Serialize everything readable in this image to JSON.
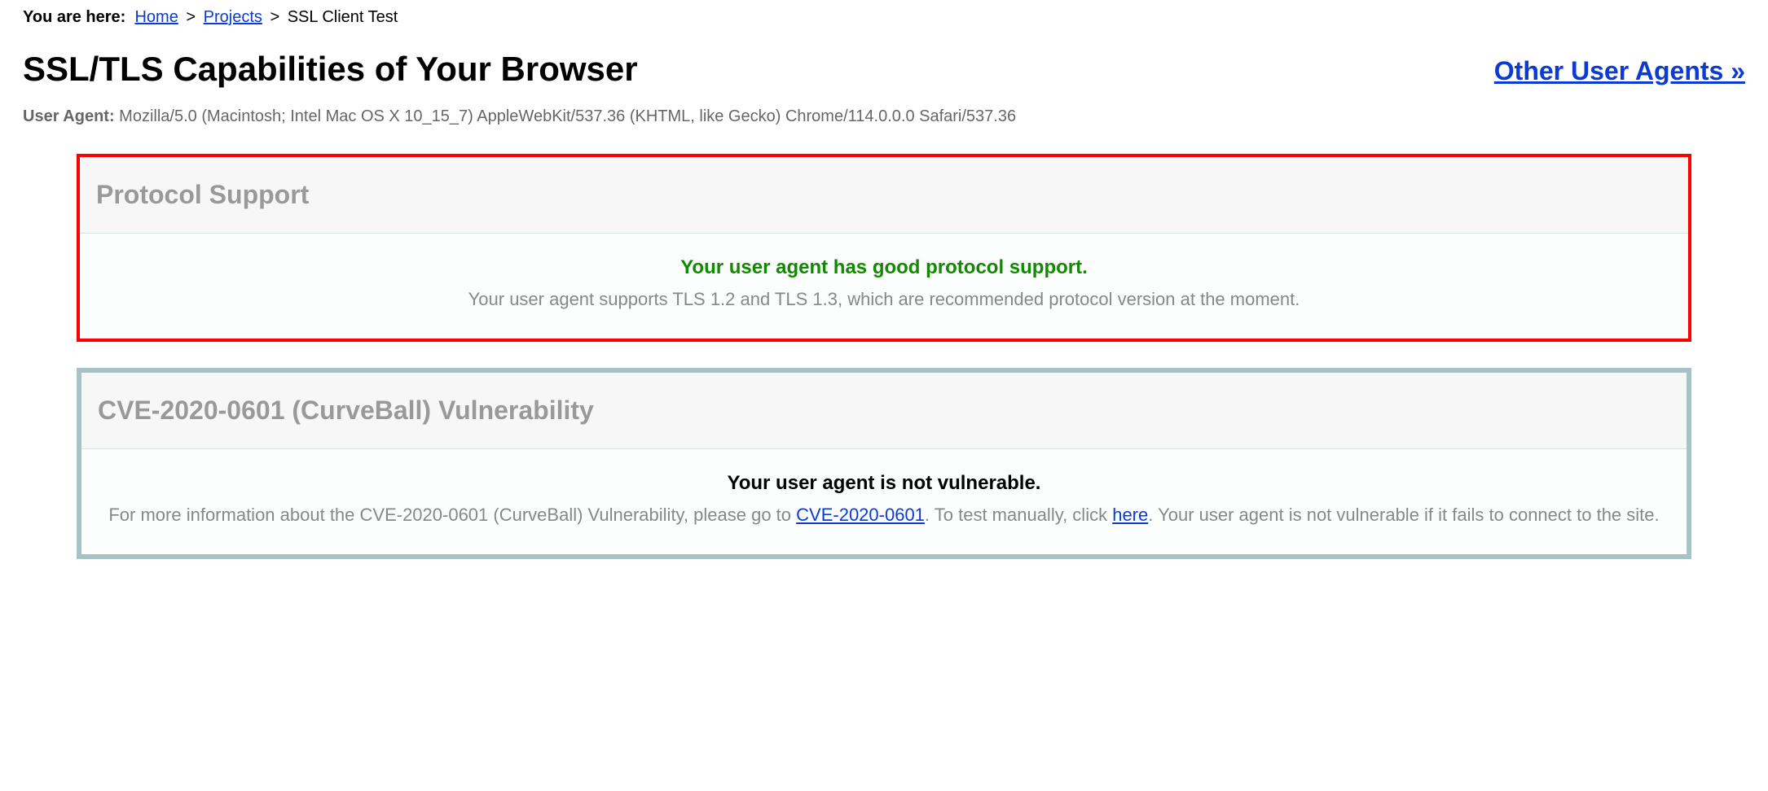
{
  "breadcrumb": {
    "label": "You are here:",
    "home": "Home",
    "projects": "Projects",
    "current": "SSL Client Test",
    "sep": ">"
  },
  "page_title": "SSL/TLS Capabilities of Your Browser",
  "other_agents_link": "Other User Agents »",
  "user_agent": {
    "label": "User Agent:",
    "value": "Mozilla/5.0 (Macintosh; Intel Mac OS X 10_15_7) AppleWebKit/537.36 (KHTML, like Gecko) Chrome/114.0.0.0 Safari/537.36"
  },
  "protocol_panel": {
    "title": "Protocol Support",
    "status": "Your user agent has good protocol support.",
    "desc": "Your user agent supports TLS 1.2 and TLS 1.3, which are recommended protocol version at the moment."
  },
  "cve_panel": {
    "title": "CVE-2020-0601 (CurveBall) Vulnerability",
    "status": "Your user agent is not vulnerable.",
    "desc_pre": "For more information about the CVE-2020-0601 (CurveBall) Vulnerability, please go to ",
    "link1": "CVE-2020-0601",
    "desc_mid": ". To test manually, click ",
    "link2": "here",
    "desc_post": ". Your user agent is not vulnerable if it fails to connect to the site."
  }
}
